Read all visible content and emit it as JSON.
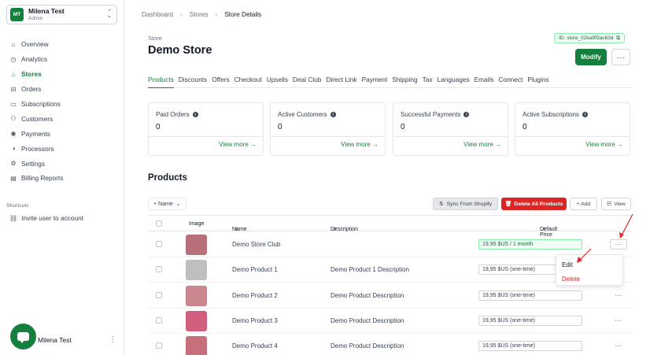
{
  "org": {
    "badge": "MT",
    "name": "Milena Test",
    "role": "Admin"
  },
  "nav": [
    {
      "label": "Overview",
      "icon": "home-icon",
      "glyph": "⌂"
    },
    {
      "label": "Analytics",
      "icon": "clock-icon",
      "glyph": "◷"
    },
    {
      "label": "Stores",
      "icon": "store-icon",
      "glyph": "⌂"
    },
    {
      "label": "Orders",
      "icon": "cart-icon",
      "glyph": "⊟"
    },
    {
      "label": "Subscriptions",
      "icon": "subscription-icon",
      "glyph": "▭"
    },
    {
      "label": "Customers",
      "icon": "user-icon",
      "glyph": "⚇"
    },
    {
      "label": "Payments",
      "icon": "payment-icon",
      "glyph": "◉"
    },
    {
      "label": "Processors",
      "icon": "processor-icon",
      "glyph": "◑"
    },
    {
      "label": "Settings",
      "icon": "gear-icon",
      "glyph": "⚙"
    },
    {
      "label": "Billing Reports",
      "icon": "report-icon",
      "glyph": "▤"
    }
  ],
  "shortcuts": {
    "title": "Shortcuts",
    "item": "Invite user to account"
  },
  "user": {
    "name": "Milena Test"
  },
  "breadcrumb": {
    "b1": "Dashboard",
    "b2": "Stores",
    "b3": "Store Details"
  },
  "store": {
    "label": "Store",
    "title": "Demo Store",
    "id": "ID: store_02ea9f3ac63d"
  },
  "actions": {
    "modify": "Modify",
    "more": "···"
  },
  "tabs": [
    "Products",
    "Discounts",
    "Offers",
    "Checkout",
    "Upsells",
    "Deal Club",
    "Direct Link",
    "Payment",
    "Shipping",
    "Tax",
    "Languages",
    "Emails",
    "Connect",
    "Plugins"
  ],
  "stats": [
    {
      "label": "Paid Orders",
      "value": "0",
      "link": "View more →"
    },
    {
      "label": "Active Customers",
      "value": "0",
      "link": "View more →"
    },
    {
      "label": "Successful Payments",
      "value": "0",
      "link": "View more →"
    },
    {
      "label": "Active Subscriptions",
      "value": "0",
      "link": "View more →"
    }
  ],
  "products": {
    "title": "Products",
    "filter": "+ Name",
    "sync": "Sync From Shopify",
    "delete_all": "Delete All Products",
    "add": "+ Add",
    "view": "View",
    "columns": {
      "image": "Image",
      "name": "Name",
      "description": "Description",
      "price": "Default Price"
    },
    "rows": [
      {
        "name": "Demo Store Club",
        "description": "",
        "price": "19,95 $US / 1 month",
        "color": "#b86f7a"
      },
      {
        "name": "Demo Product 1",
        "description": "Demo Product 1 Description",
        "price": "19,95 $US (one-time)",
        "color": "#bfbfbf"
      },
      {
        "name": "Demo Product 2",
        "description": "Demo Product Description",
        "price": "19,95 $US (one-time)",
        "color": "#c9868d"
      },
      {
        "name": "Demo Product 3",
        "description": "Demo Product Description",
        "price": "19,95 $US (one-time)",
        "color": "#d25d7c"
      },
      {
        "name": "Demo Product 4",
        "description": "Demo Product Description",
        "price": "19,95 $US (one-time)",
        "color": "#c7707c"
      }
    ]
  },
  "row_menu": {
    "edit": "Edit",
    "delete": "Delete"
  }
}
